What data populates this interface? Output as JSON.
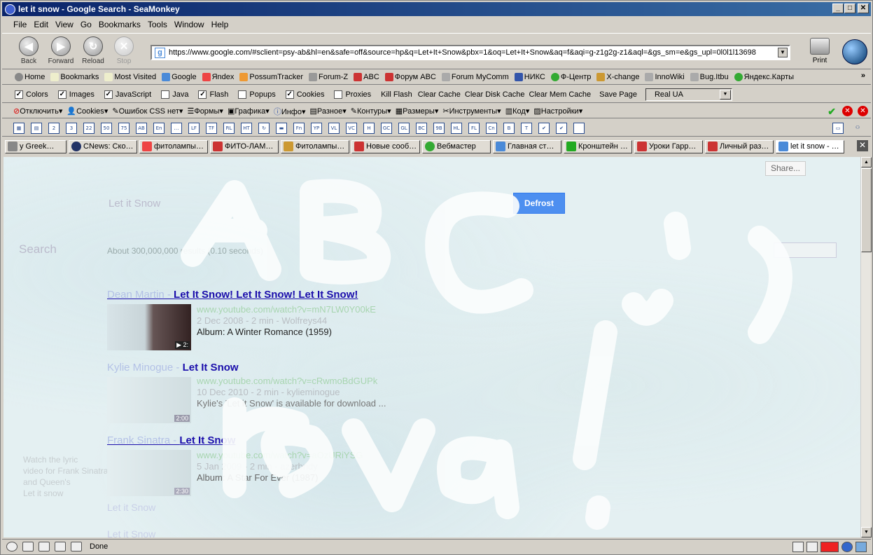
{
  "window": {
    "title": "let it snow - Google Search - SeaMonkey"
  },
  "menu": [
    "File",
    "Edit",
    "View",
    "Go",
    "Bookmarks",
    "Tools",
    "Window",
    "Help"
  ],
  "nav": {
    "back": "Back",
    "forward": "Forward",
    "reload": "Reload",
    "stop": "Stop",
    "print": "Print"
  },
  "url": "https://www.google.com/#sclient=psy-ab&hl=en&safe=off&source=hp&q=Let+It+Snow&pbx=1&oq=Let+It+Snow&aq=f&aqi=g-z1g2g-z1&aql=&gs_sm=e&gs_upl=0l0l1l13698",
  "bookmarks": [
    "Home",
    "Bookmarks",
    "Most Visited",
    "Google",
    "Яndex",
    "PossumTracker",
    "Forum-Z",
    "ABC",
    "Форум ABC",
    "Forum MyComm",
    "НИКС",
    "Ф-Центр",
    "X-change",
    "InnoWiki",
    "Bug.Itbu",
    "Яндекс.Карты"
  ],
  "webdev": {
    "checks": [
      {
        "label": "Colors",
        "checked": true
      },
      {
        "label": "Images",
        "checked": true
      },
      {
        "label": "JavaScript",
        "checked": true
      },
      {
        "label": "Java",
        "checked": false
      },
      {
        "label": "Flash",
        "checked": true
      },
      {
        "label": "Popups",
        "checked": false
      },
      {
        "label": "Cookies",
        "checked": true
      },
      {
        "label": "Proxies",
        "checked": false
      }
    ],
    "buttons": [
      "Kill Flash",
      "Clear Cache",
      "Clear Disk Cache",
      "Clear Mem Cache",
      "Save Page"
    ],
    "select": "Real UA"
  },
  "rutoolbar": [
    "Отключить",
    "Cookies",
    "Ошибок CSS нет",
    "Формы",
    "Графика",
    "Инфо",
    "Разное",
    "Контуры",
    "Размеры",
    "Инструменты",
    "Код",
    "Настройки"
  ],
  "iconbar": [
    "2",
    "3",
    "22",
    "50",
    "75",
    "AB",
    "En",
    "…",
    "LF",
    "TF",
    "RL",
    "HT",
    "↻",
    "▬",
    "Fn",
    "YP",
    "VL",
    "VC",
    "H",
    "GC",
    "GL",
    "BC",
    "9B",
    "HL",
    "FL",
    "Cn",
    "B",
    "T",
    "✔",
    "✔",
    ""
  ],
  "tabs": [
    "y Greek…",
    "CNews: Ско…",
    "фитолампы…",
    "ФИТО-ЛАМ…",
    "Фитолампы…",
    "Новые сооб…",
    "Вебмастер",
    "Главная ст…",
    "Кронштейн …",
    "Уроки Гарр…",
    "Личный раз…",
    "let it snow - …"
  ],
  "page": {
    "share": "Share...",
    "defrost": "Defrost",
    "query": "Let it Snow",
    "search_label": "Search",
    "result_stats": "About 300,000,000 results (0.10 seconds)",
    "sidebar_text": [
      "Watch the lyric",
      "video for Frank Sinatra",
      "and Queen's",
      "Let it snow"
    ],
    "results": [
      {
        "title_pre": "Dean Martin - ",
        "title_bold": "Let It Snow! Let It Snow! Let It Snow!",
        "url": "www.youtube.com/watch?v=mN7LW0Y00kE",
        "meta": "2 Dec 2008 - 2 min - Wolfreys44",
        "desc": "Album: A Winter Romance (1959)",
        "dur": "2:"
      },
      {
        "title_pre": "Kylie Minogue - ",
        "title_bold": "Let It Snow",
        "url": "www.youtube.com/watch?v=cRwmoBdGUPk",
        "meta": "10 Dec 2010 - 2 min - kylieminogue",
        "desc": "Kylie's 'Let it Snow' is available for download ...",
        "dur": "2:00"
      },
      {
        "title_pre": "Frank Sinatra - ",
        "title_bold": "Let It Snow",
        "url": "www.youtube.com/watch?v=aOzURiYSG",
        "meta": "5 Jan 2009 - 2 min - azerbridy",
        "desc": "Album: A Star For Ever (1987)",
        "dur": "2:30"
      }
    ],
    "more_text": "Let it Snow",
    "bottom_text": "Let it Snow"
  },
  "status": {
    "text": "Done"
  }
}
